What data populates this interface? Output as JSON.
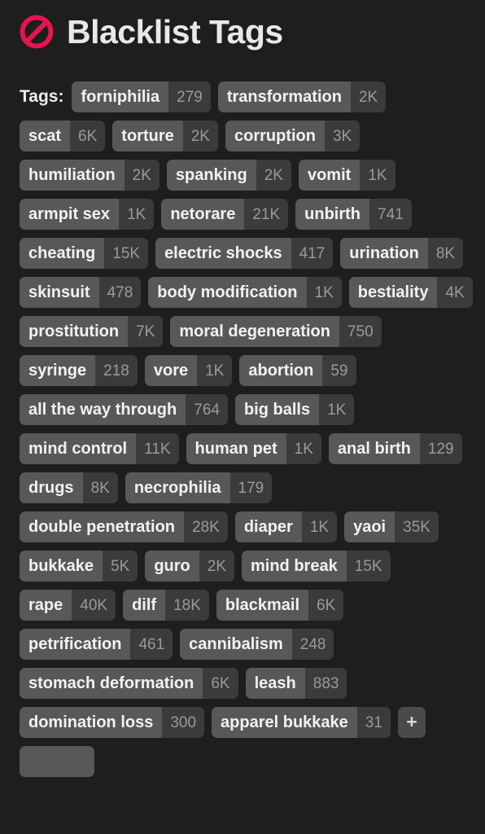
{
  "header": {
    "icon": "prohibition-icon",
    "icon_color": "#e8134f",
    "title": "Blacklist Tags"
  },
  "colors": {
    "background": "#1e1e1e",
    "pill_label_bg": "#585858",
    "pill_count_bg": "#3b3b3b",
    "pill_label_text": "#f2f2f2",
    "pill_count_text": "#9a9a9a",
    "title_text": "#e8e8e8",
    "accent": "#e8134f"
  },
  "tag_section": {
    "label": "Tags:",
    "add_button_label": "+",
    "tags": [
      {
        "name": "forniphilia",
        "count": "279"
      },
      {
        "name": "transformation",
        "count": "2K"
      },
      {
        "name": "scat",
        "count": "6K"
      },
      {
        "name": "torture",
        "count": "2K"
      },
      {
        "name": "corruption",
        "count": "3K"
      },
      {
        "name": "humiliation",
        "count": "2K"
      },
      {
        "name": "spanking",
        "count": "2K"
      },
      {
        "name": "vomit",
        "count": "1K"
      },
      {
        "name": "armpit sex",
        "count": "1K"
      },
      {
        "name": "netorare",
        "count": "21K"
      },
      {
        "name": "unbirth",
        "count": "741"
      },
      {
        "name": "cheating",
        "count": "15K"
      },
      {
        "name": "electric shocks",
        "count": "417"
      },
      {
        "name": "urination",
        "count": "8K"
      },
      {
        "name": "skinsuit",
        "count": "478"
      },
      {
        "name": "body modification",
        "count": "1K"
      },
      {
        "name": "bestiality",
        "count": "4K"
      },
      {
        "name": "prostitution",
        "count": "7K"
      },
      {
        "name": "moral degeneration",
        "count": "750"
      },
      {
        "name": "syringe",
        "count": "218"
      },
      {
        "name": "vore",
        "count": "1K"
      },
      {
        "name": "abortion",
        "count": "59"
      },
      {
        "name": "all the way through",
        "count": "764"
      },
      {
        "name": "big balls",
        "count": "1K"
      },
      {
        "name": "mind control",
        "count": "11K"
      },
      {
        "name": "human pet",
        "count": "1K"
      },
      {
        "name": "anal birth",
        "count": "129"
      },
      {
        "name": "drugs",
        "count": "8K"
      },
      {
        "name": "necrophilia",
        "count": "179"
      },
      {
        "name": "double penetration",
        "count": "28K"
      },
      {
        "name": "diaper",
        "count": "1K"
      },
      {
        "name": "yaoi",
        "count": "35K"
      },
      {
        "name": "bukkake",
        "count": "5K"
      },
      {
        "name": "guro",
        "count": "2K"
      },
      {
        "name": "mind break",
        "count": "15K"
      },
      {
        "name": "rape",
        "count": "40K"
      },
      {
        "name": "dilf",
        "count": "18K"
      },
      {
        "name": "blackmail",
        "count": "6K"
      },
      {
        "name": "petrification",
        "count": "461"
      },
      {
        "name": "cannibalism",
        "count": "248"
      },
      {
        "name": "stomach deformation",
        "count": "6K"
      },
      {
        "name": "leash",
        "count": "883"
      },
      {
        "name": "domination loss",
        "count": "300"
      },
      {
        "name": "apparel bukkake",
        "count": "31"
      }
    ]
  }
}
